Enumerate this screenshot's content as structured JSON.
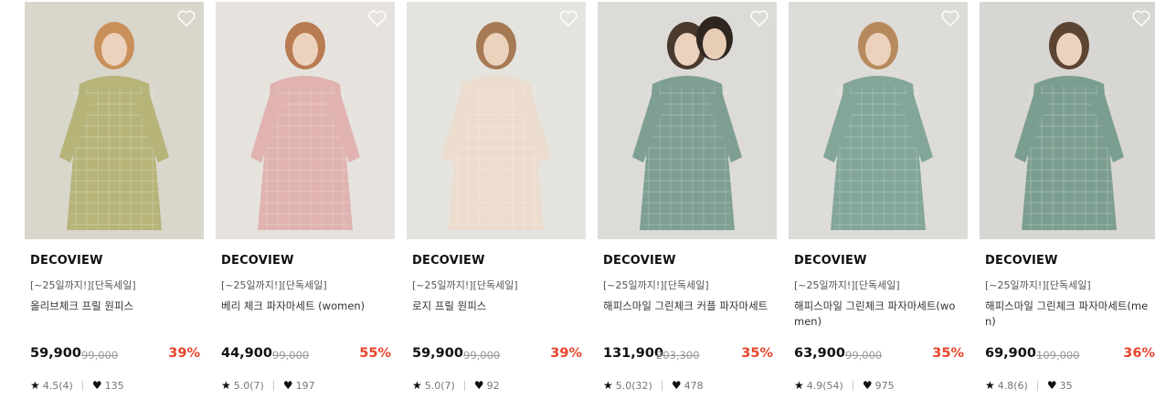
{
  "accent_color": "#e8442a",
  "products": [
    {
      "brand": "DECOVIEW",
      "promo": "[~25일까지!][단독세일]",
      "name": "올리브체크 프릴 원피스",
      "price": "59,900",
      "original_price": "99,000",
      "discount": "39%",
      "rating": "4.5(4)",
      "likes": "135",
      "image_colors": {
        "bg": "#d9d6cc",
        "garment": "#b7b47a",
        "hair": "#c9905a"
      }
    },
    {
      "brand": "DECOVIEW",
      "promo": "[~25일까지!][단독세일]",
      "name": "베리 체크 파자마세트 (women)",
      "price": "44,900",
      "original_price": "99,000",
      "discount": "55%",
      "rating": "5.0(7)",
      "likes": "197",
      "image_colors": {
        "bg": "#e6e3de",
        "garment": "#e0b3b0",
        "hair": "#b97b52"
      }
    },
    {
      "brand": "DECOVIEW",
      "promo": "[~25일까지!][단독세일]",
      "name": "로지 프릴 원피스",
      "price": "59,900",
      "original_price": "99,000",
      "discount": "39%",
      "rating": "5.0(7)",
      "likes": "92",
      "image_colors": {
        "bg": "#e4e3de",
        "garment": "#ecdccd",
        "hair": "#a67a55"
      }
    },
    {
      "brand": "DECOVIEW",
      "promo": "[~25일까지!][단독세일]",
      "name": "해피스마일 그린체크 커플 파자마세트",
      "price": "131,900",
      "original_price": "203,300",
      "discount": "35%",
      "rating": "5.0(32)",
      "likes": "478",
      "image_colors": {
        "bg": "#dcdbd8",
        "garment": "#7e9f92",
        "hair": "#4a3a2e"
      }
    },
    {
      "brand": "DECOVIEW",
      "promo": "[~25일까지!][단독세일]",
      "name": "해피스마일 그린체크 파자마세트(women)",
      "price": "63,900",
      "original_price": "99,000",
      "discount": "35%",
      "rating": "4.9(54)",
      "likes": "975",
      "image_colors": {
        "bg": "#dedcd8",
        "garment": "#83a699",
        "hair": "#b68a5c"
      }
    },
    {
      "brand": "DECOVIEW",
      "promo": "[~25일까지!][단독세일]",
      "name": "해피스마일 그린체크 파자마세트(men)",
      "price": "69,900",
      "original_price": "109,000",
      "discount": "36%",
      "rating": "4.8(6)",
      "likes": "35",
      "image_colors": {
        "bg": "#d8d6d2",
        "garment": "#7c9e90",
        "hair": "#5b4431"
      }
    }
  ]
}
